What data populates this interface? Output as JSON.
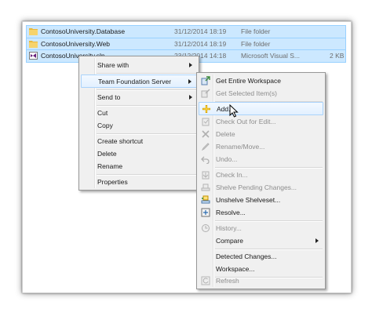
{
  "files": [
    {
      "name": "ContosoUniversity.Database",
      "date": "31/12/2014 18:19",
      "type": "File folder",
      "size": "",
      "icon": "folder-icon",
      "selected": true
    },
    {
      "name": "ContosoUniversity.Web",
      "date": "31/12/2014 18:19",
      "type": "File folder",
      "size": "",
      "icon": "folder-icon",
      "selected": true
    },
    {
      "name": "ContosoUniversity.sln",
      "date": "23/12/2014 14:18",
      "type": "Microsoft Visual S...",
      "size": "2 KB",
      "icon": "solution-file-icon",
      "selected": true
    }
  ],
  "context_menu": {
    "share_with": "Share with",
    "tfs": "Team Foundation Server",
    "send_to": "Send to",
    "cut": "Cut",
    "copy": "Copy",
    "create_shortcut": "Create shortcut",
    "delete": "Delete",
    "rename": "Rename",
    "properties": "Properties"
  },
  "tfs_menu": {
    "get_entire_workspace": "Get Entire Workspace",
    "get_selected_items": "Get Selected Item(s)",
    "add": "Add...",
    "check_out_for_edit": "Check Out for Edit...",
    "delete": "Delete",
    "rename_move": "Rename/Move...",
    "undo": "Undo...",
    "check_in": "Check In...",
    "shelve_pending_changes": "Shelve Pending Changes...",
    "unshelve_shelveset": "Unshelve Shelveset...",
    "resolve": "Resolve...",
    "history": "History...",
    "compare": "Compare",
    "detected_changes": "Detected Changes...",
    "workspace": "Workspace...",
    "refresh": "Refresh"
  },
  "colors": {
    "selection_bg": "#cce8ff",
    "selection_border": "#99d1ff",
    "menu_bg": "#f0f0f0",
    "highlight_border": "#aad3fb",
    "disabled_text": "#8d8d8d"
  }
}
